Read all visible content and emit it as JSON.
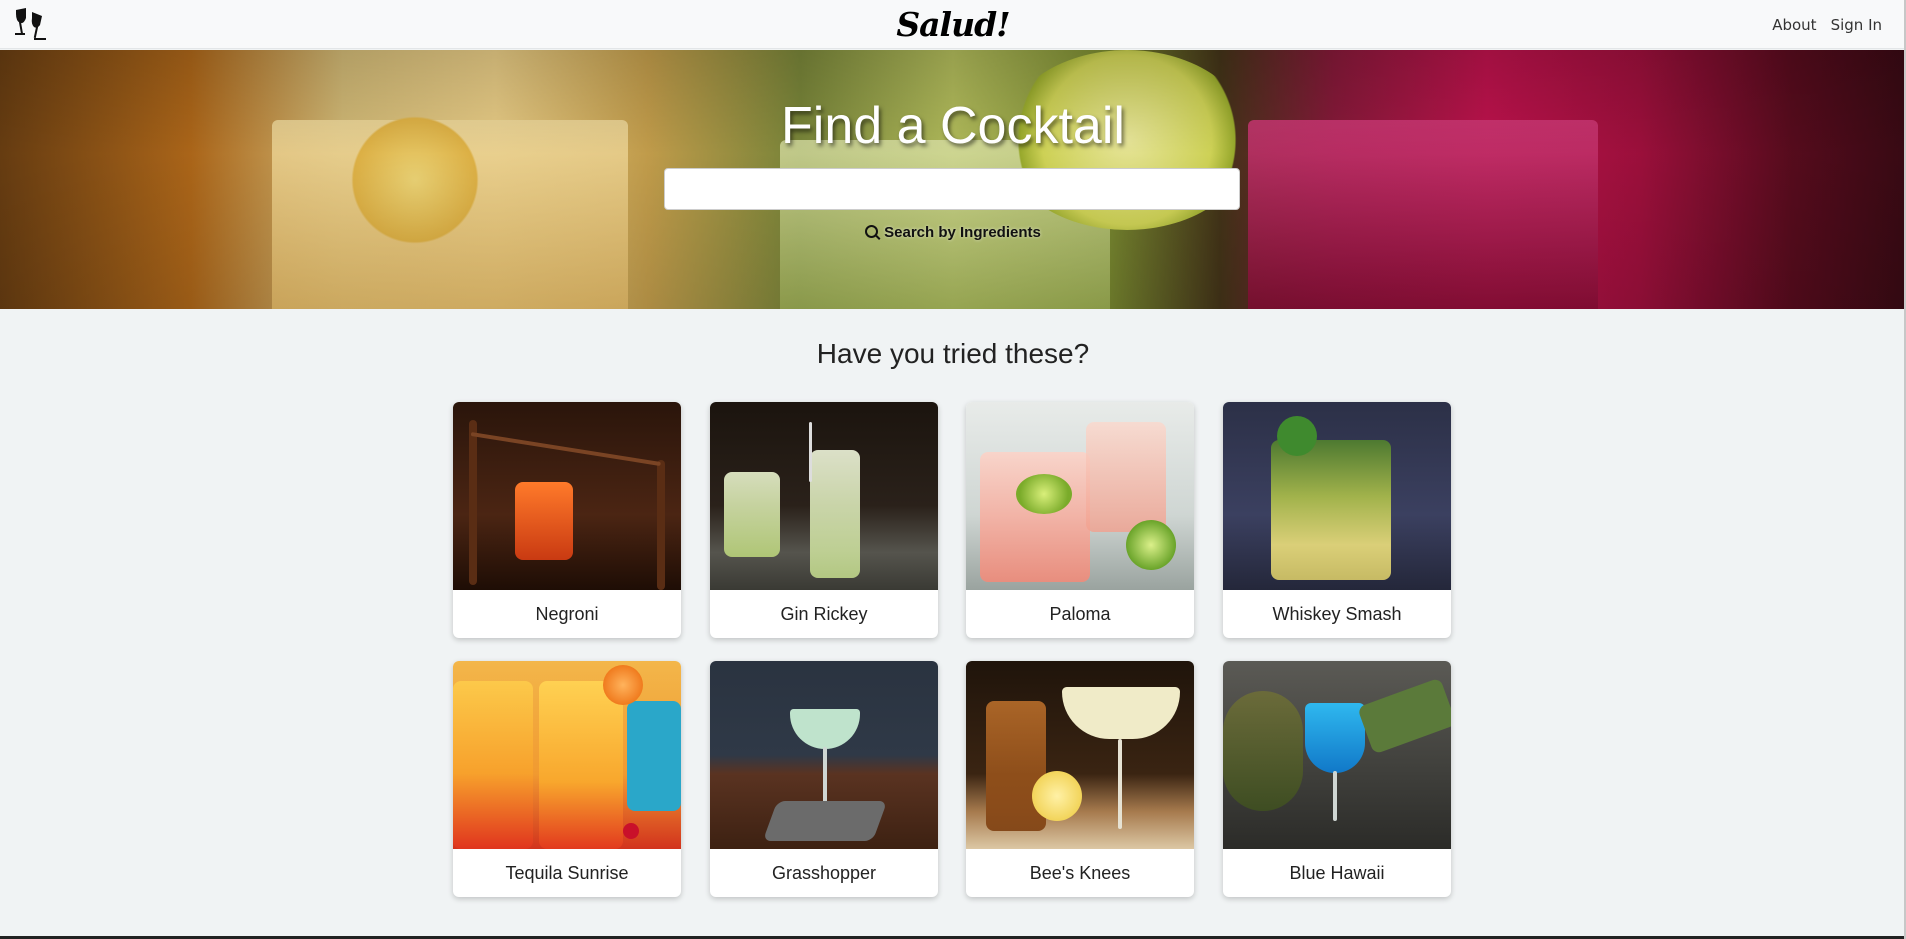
{
  "navbar": {
    "brand": "Salud!",
    "links": {
      "about": "About",
      "sign_in": "Sign In"
    }
  },
  "hero": {
    "title": "Find a Cocktail",
    "search_placeholder": "",
    "search_value": "",
    "ingredient_link": "Search by Ingredients"
  },
  "section": {
    "title": "Have you tried these?",
    "cocktails": [
      {
        "name": "Negroni"
      },
      {
        "name": "Gin Rickey"
      },
      {
        "name": "Paloma"
      },
      {
        "name": "Whiskey Smash"
      },
      {
        "name": "Tequila Sunrise"
      },
      {
        "name": "Grasshopper"
      },
      {
        "name": "Bee's Knees"
      },
      {
        "name": "Blue Hawaii"
      }
    ]
  },
  "icons": {
    "brand": "cheers-glasses-icon",
    "ingredient_search": "search-icon"
  }
}
